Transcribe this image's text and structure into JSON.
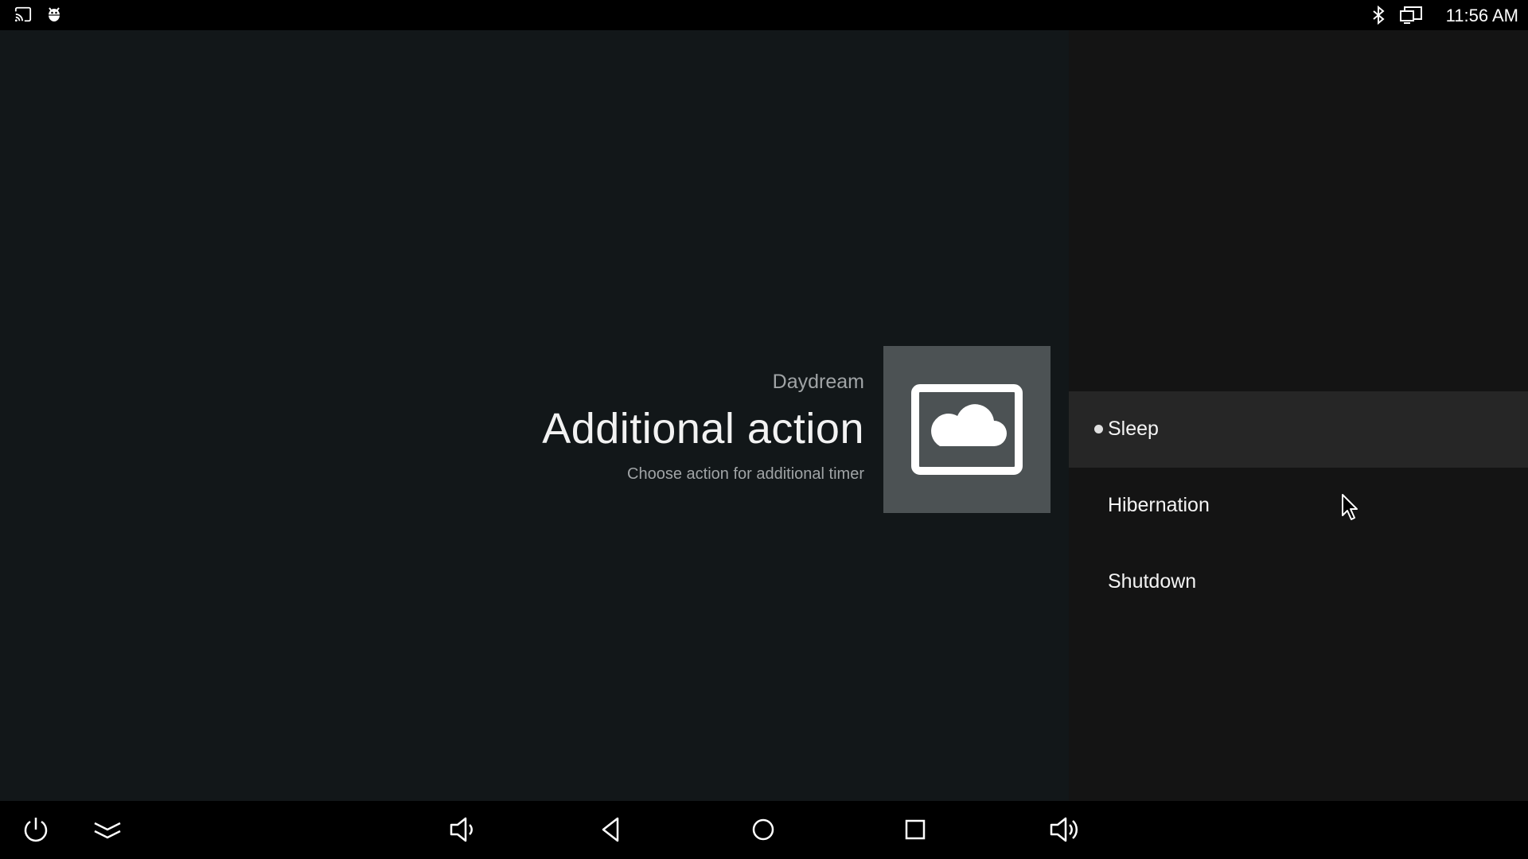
{
  "status_bar": {
    "time": "11:56 AM",
    "left_icons": [
      "cast-icon",
      "android-debug-icon"
    ],
    "right_icons": [
      "bluetooth-icon",
      "display-icon"
    ]
  },
  "guidance": {
    "breadcrumb": "Daydream",
    "title": "Additional action",
    "description": "Choose action for additional timer",
    "icon": "daydream-cloud-icon"
  },
  "actions": {
    "items": [
      {
        "label": "Sleep",
        "selected": true
      },
      {
        "label": "Hibernation",
        "selected": false
      },
      {
        "label": "Shutdown",
        "selected": false
      }
    ]
  },
  "nav_bar": {
    "buttons": [
      "power-icon",
      "collapse-icon",
      "volume-down-icon",
      "back-icon",
      "home-icon",
      "recents-icon",
      "volume-up-icon"
    ]
  },
  "colors": {
    "background": "#121719",
    "side_panel": "#141414",
    "selected_row": "#262626",
    "icon_tile": "#4c5254"
  }
}
